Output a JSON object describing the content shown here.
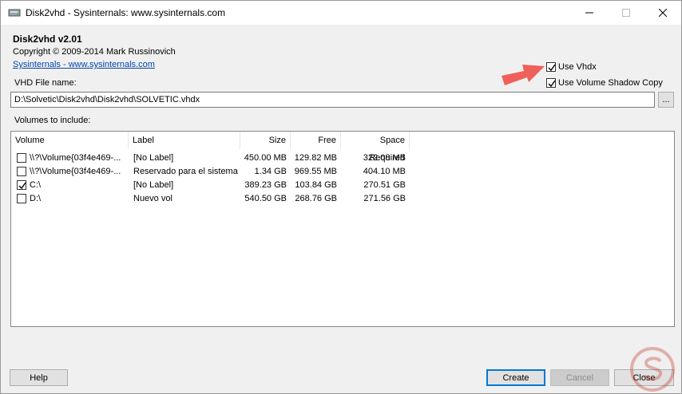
{
  "window": {
    "title": "Disk2vhd - Sysinternals: www.sysinternals.com"
  },
  "header": {
    "app_title": "Disk2vhd v2.01",
    "copyright": "Copyright  © 2009-2014 Mark Russinovich",
    "link": "Sysinternals - www.sysinternals.com"
  },
  "options": {
    "use_vhdx": {
      "label": "Use Vhdx",
      "checked": true
    },
    "use_vss": {
      "label": "Use Volume Shadow Copy",
      "checked": true
    }
  },
  "file": {
    "label": "VHD File name:",
    "value": "D:\\Solvetic\\Disk2vhd\\Disk2vhd\\SOLVETIC.vhdx",
    "browse_label": "..."
  },
  "volumes": {
    "label": "Volumes to include:",
    "columns": [
      "Volume",
      "Label",
      "Size",
      "Free",
      "Space Required"
    ],
    "rows": [
      {
        "checked": false,
        "volume": "\\\\?\\Volume{03f4e469-...",
        "label": "[No Label]",
        "size": "450.00 MB",
        "free": "129.82 MB",
        "required": "322.08 MB"
      },
      {
        "checked": false,
        "volume": "\\\\?\\Volume{03f4e469-...",
        "label": "Reservado para el sistema",
        "size": "1.34 GB",
        "free": "969.55 MB",
        "required": "404.10 MB"
      },
      {
        "checked": true,
        "volume": "C:\\",
        "label": "[No Label]",
        "size": "389.23 GB",
        "free": "103.84 GB",
        "required": "270.51 GB"
      },
      {
        "checked": false,
        "volume": "D:\\",
        "label": "Nuevo vol",
        "size": "540.50 GB",
        "free": "268.76 GB",
        "required": "271.56 GB"
      }
    ]
  },
  "buttons": {
    "help": "Help",
    "create": "Create",
    "cancel": "Cancel",
    "close": "Close"
  },
  "colors": {
    "accent": "#0078d7",
    "link": "#0645ad",
    "arrow": "#f0605a"
  },
  "icons": {
    "app": "disk-icon",
    "minimize": "minimize-icon",
    "maximize": "maximize-icon",
    "close": "close-icon"
  }
}
